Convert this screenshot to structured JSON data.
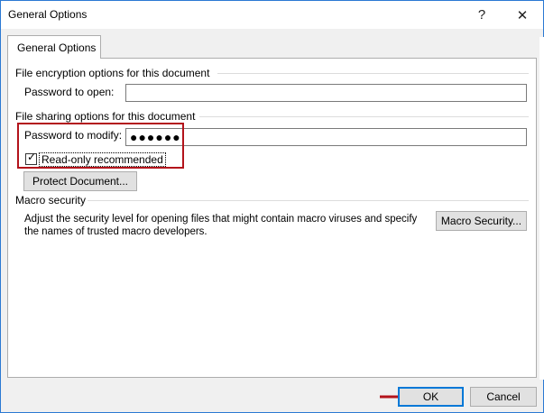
{
  "window": {
    "title": "General Options",
    "help_glyph": "?",
    "close_glyph": "✕"
  },
  "tab": {
    "label": "General Options"
  },
  "encryption": {
    "group_label": "File encryption options for this document",
    "password_open_label": "Password to open:",
    "password_open_value": ""
  },
  "sharing": {
    "group_label": "File sharing options for this document",
    "password_modify_label": "Password to modify:",
    "password_modify_value": "●●●●●●",
    "readonly_label": "Read-only recommended",
    "readonly_checked": true,
    "protect_button": "Protect Document..."
  },
  "macro": {
    "group_label": "Macro security",
    "description": "Adjust the security level for opening files that might contain macro viruses and specify the names of trusted macro developers.",
    "button": "Macro Security..."
  },
  "footer": {
    "ok_button": "OK",
    "cancel_button": "Cancel"
  },
  "colors": {
    "accent": "#0078d7",
    "highlight": "#b3131b"
  },
  "icons": {
    "check": "✓",
    "arrow": "arrow-right-icon"
  }
}
